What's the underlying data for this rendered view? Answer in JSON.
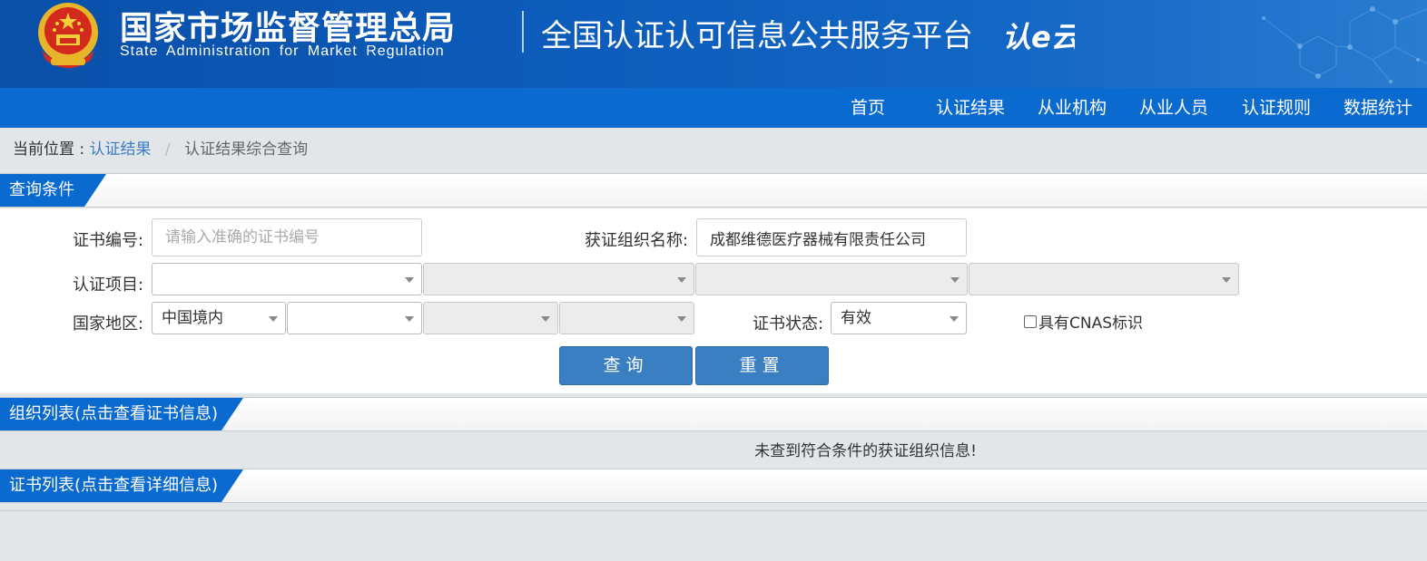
{
  "header": {
    "agency_cn": "国家市场监督管理总局",
    "agency_en": "State Administration for Market Regulation",
    "platform_title": "全国认证认可信息公共服务平台",
    "platform_logo_text": "认e云"
  },
  "nav": {
    "items": [
      {
        "label": "首页"
      },
      {
        "label": "认证结果"
      },
      {
        "label": "从业机构"
      },
      {
        "label": "从业人员"
      },
      {
        "label": "认证规则"
      },
      {
        "label": "数据统计"
      }
    ]
  },
  "breadcrumb": {
    "prefix": "当前位置 :",
    "link": "认证结果",
    "separator": "/",
    "current": "认证结果综合查询"
  },
  "query_section": {
    "title": "查询条件",
    "cert_no_label": "证书编号:",
    "cert_no_placeholder": "请输入准确的证书编号",
    "cert_no_value": "",
    "org_name_label": "获证组织名称:",
    "org_name_value": "成都维德医疗器械有限责任公司",
    "project_label": "认证项目:",
    "project_selects": [
      "",
      "",
      "",
      ""
    ],
    "region_label": "国家地区:",
    "region_selects": [
      "中国境内",
      "",
      "",
      ""
    ],
    "status_label": "证书状态:",
    "status_value": "有效",
    "cnas_label": "具有CNAS标识",
    "search_button": "查询",
    "reset_button": "重置"
  },
  "org_section": {
    "title": "组织列表(点击查看证书信息)",
    "empty_message": "未查到符合条件的获证组织信息!"
  },
  "cert_section": {
    "title": "证书列表(点击查看详细信息)"
  },
  "colors": {
    "banner": "#0d5cbb",
    "nav": "#0a6ad0",
    "button": "#3a7fc1",
    "link": "#3b7bc4"
  }
}
